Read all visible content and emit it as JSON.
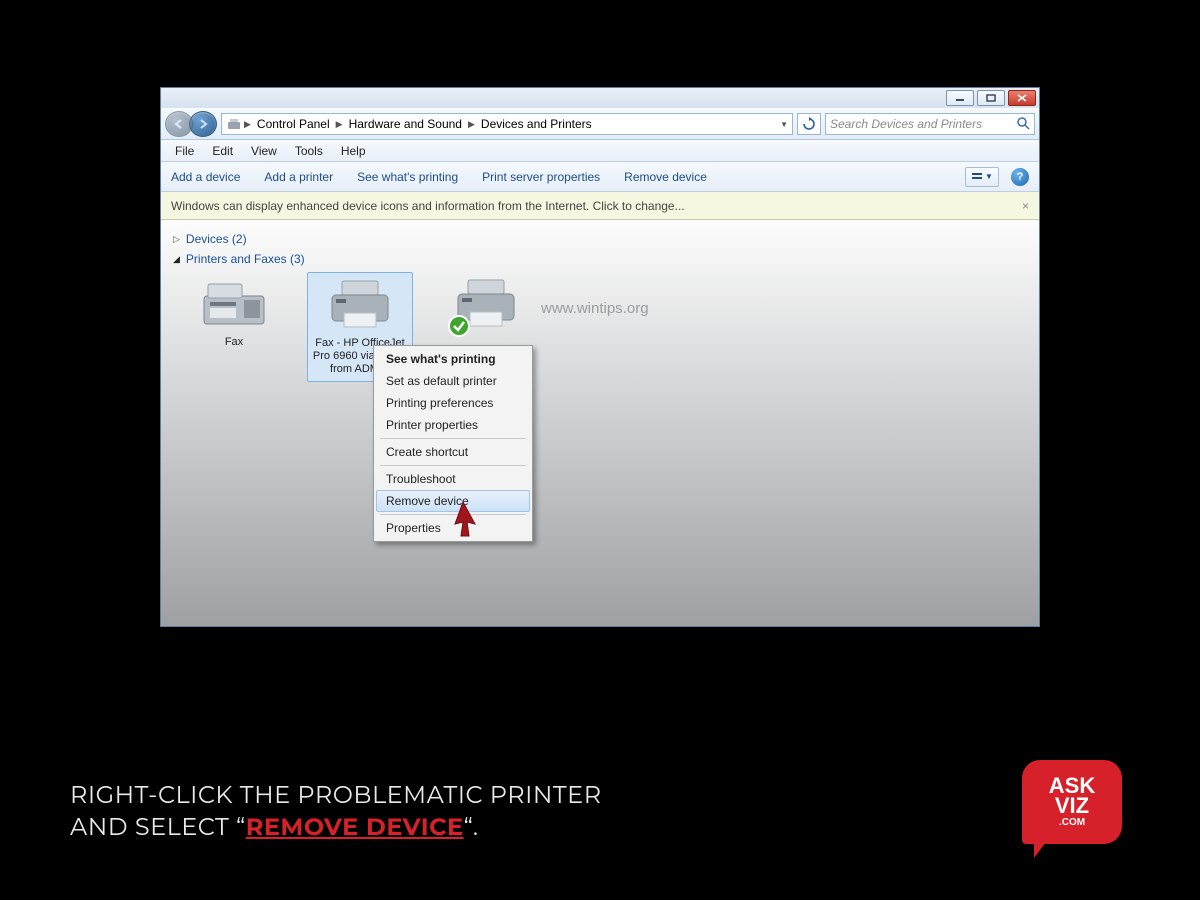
{
  "breadcrumb": {
    "seg1": "Control Panel",
    "seg2": "Hardware and Sound",
    "seg3": "Devices and Printers"
  },
  "search": {
    "placeholder": "Search Devices and Printers"
  },
  "menu": {
    "file": "File",
    "edit": "Edit",
    "view": "View",
    "tools": "Tools",
    "help": "Help"
  },
  "toolbar": {
    "add_device": "Add a device",
    "add_printer": "Add a printer",
    "see_printing": "See what's printing",
    "server_props": "Print server properties",
    "remove": "Remove device"
  },
  "infobar": {
    "text": "Windows can display enhanced device icons and information from the Internet. Click to change..."
  },
  "groups": {
    "devices": "Devices (2)",
    "printers": "Printers and Faxes (3)"
  },
  "devices": {
    "fax": "Fax",
    "selected": "Fax - HP OfficeJet Pro 6960 via DOT4 from ADMIN"
  },
  "watermark": "www.wintips.org",
  "context": {
    "see": "See what's printing",
    "default": "Set as default printer",
    "prefs": "Printing preferences",
    "props": "Printer properties",
    "shortcut": "Create shortcut",
    "trouble": "Troubleshoot",
    "remove": "Remove device",
    "properties": "Properties"
  },
  "caption": {
    "line1": "RIGHT-CLICK THE PROBLEMATIC PRINTER",
    "line2a": "AND SELECT “",
    "highlight": "REMOVE DEVICE",
    "line2b": "“."
  },
  "logo": {
    "t1": "ASK",
    "t2": "VIZ",
    "t3": ".COM"
  }
}
